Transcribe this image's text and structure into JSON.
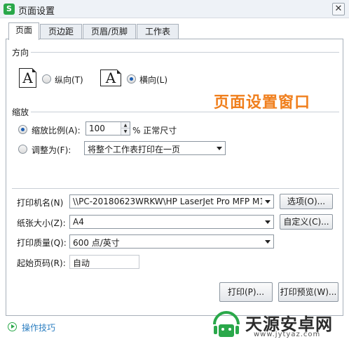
{
  "window": {
    "title": "页面设置",
    "app_icon_letter": "S",
    "close_glyph": "✕"
  },
  "tabs": [
    {
      "label": "页面",
      "active": true
    },
    {
      "label": "页边距",
      "active": false
    },
    {
      "label": "页眉/页脚",
      "active": false
    },
    {
      "label": "工作表",
      "active": false
    }
  ],
  "orientation": {
    "section_title": "方向",
    "portrait_icon_letter": "A",
    "portrait_label": "纵向(T)",
    "landscape_icon_letter": "A",
    "landscape_label": "横向(L)",
    "selected": "landscape"
  },
  "annotation": "页面设置窗口",
  "scaling": {
    "section_title": "缩放",
    "scale_label": "缩放比例(A):",
    "scale_value": "100",
    "scale_suffix": "% 正常尺寸",
    "fit_label": "调整为(F):",
    "fit_value": "将整个工作表打印在一页",
    "selected": "scale"
  },
  "printer": {
    "printer_label": "打印机名(N)",
    "printer_value": "\\\\PC-20180623WRKW\\HP LaserJet Pro MFP M1",
    "options_button": "选项(O)...",
    "paper_label": "纸张大小(Z):",
    "paper_value": "A4",
    "custom_button": "自定义(C)...",
    "quality_label": "打印质量(Q):",
    "quality_value": "600 点/英寸",
    "first_page_label": "起始页码(R):",
    "first_page_value": "自动"
  },
  "actions": {
    "print_button": "打印(P)...",
    "preview_button": "打印预览(W)..."
  },
  "footer": {
    "tips_link": "操作技巧"
  },
  "watermark": {
    "name": "天源安卓网",
    "url": "www.jytyaz.com"
  },
  "colors": {
    "annotation": "#f07f1d",
    "accent_green": "#2aa84a",
    "link": "#2d7fc1"
  }
}
